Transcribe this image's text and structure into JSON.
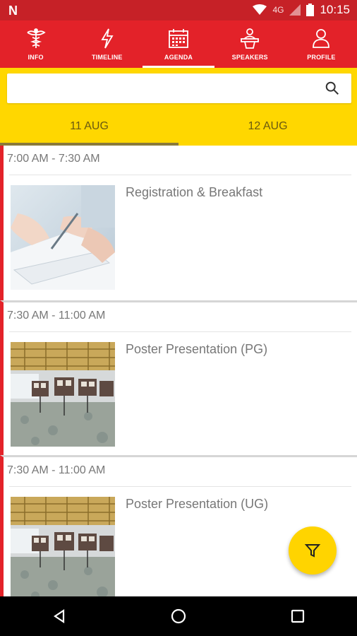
{
  "status_bar": {
    "time": "10:15",
    "network": "4G",
    "app_icon": "N"
  },
  "tabs": [
    {
      "label": "INFO",
      "icon": "caduceus-icon"
    },
    {
      "label": "TIMELINE",
      "icon": "lightning-icon"
    },
    {
      "label": "AGENDA",
      "icon": "calendar-icon"
    },
    {
      "label": "SPEAKERS",
      "icon": "speaker-podium-icon"
    },
    {
      "label": "PROFILE",
      "icon": "person-icon"
    }
  ],
  "active_tab": "AGENDA",
  "search": {
    "placeholder": "",
    "value": ""
  },
  "days": [
    {
      "label": "11 AUG",
      "active": true
    },
    {
      "label": "12 AUG",
      "active": false
    }
  ],
  "sessions": [
    {
      "time": "7:00 AM - 7:30 AM",
      "title": "Registration & Breakfast",
      "image": "paperwork-photo"
    },
    {
      "time": "7:30 AM - 11:00 AM",
      "title": "Poster Presentation (PG)",
      "image": "poster-hall-photo"
    },
    {
      "time": "7:30 AM - 11:00 AM",
      "title": "Poster Presentation (UG)",
      "image": "poster-hall-photo"
    }
  ],
  "colors": {
    "brand_red": "#e32229",
    "status_red": "#c62127",
    "accent_yellow": "#ffd700"
  }
}
